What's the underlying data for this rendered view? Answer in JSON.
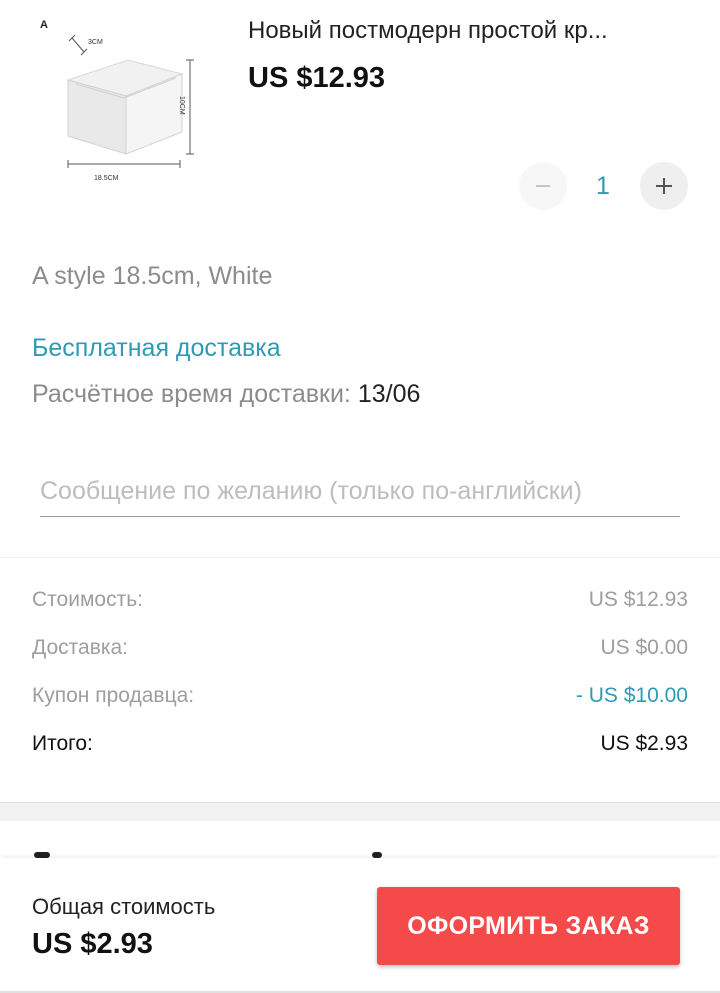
{
  "product": {
    "title": "Новый постмодерн простой кр...",
    "price": "US $12.93",
    "image": {
      "corner_label": "A",
      "dim_top": "3CM",
      "dim_side": "10CM",
      "dim_bottom": "18.5CM"
    },
    "quantity": {
      "value": "1",
      "minus_icon": "minus-icon",
      "plus_icon": "plus-icon"
    },
    "variant": "A style 18.5cm, White"
  },
  "shipping": {
    "free_label": "Бесплатная доставка",
    "eta_label": "Расчётное время доставки:",
    "eta_date": "13/06"
  },
  "message": {
    "placeholder": "Сообщение по желанию (только по-английски)"
  },
  "summary": {
    "cost_label": "Стоимость:",
    "cost_value": "US $12.93",
    "delivery_label": "Доставка:",
    "delivery_value": "US $0.00",
    "coupon_label": "Купон продавца:",
    "coupon_value": "- US $10.00",
    "total_label": "Итого:",
    "total_value": "US $2.93"
  },
  "footer": {
    "total_label": "Общая стоимость",
    "total_value": "US $2.93",
    "checkout_label": "ОФОРМИТЬ ЗАКАЗ"
  },
  "colors": {
    "accent": "#2e9bb5",
    "checkout": "#f44a4a",
    "muted": "#8c8c8c"
  }
}
